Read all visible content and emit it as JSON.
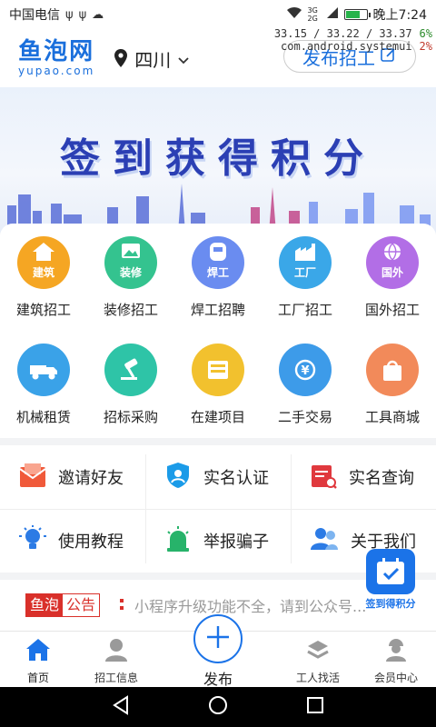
{
  "status_bar": {
    "carrier": "中国电信",
    "time": "晚上7:24",
    "battery_level": 0.75,
    "net_label": "3G 2G"
  },
  "debug_overlay": {
    "line1": "33.15 / 33.22 / 33.37",
    "line1_pct": "6%",
    "line2": "com.android.systemui",
    "line2_pct": "2%"
  },
  "header": {
    "logo_cn": "鱼泡网",
    "logo_en": "yupao.com",
    "city": "四川",
    "publish_button": "发布招工"
  },
  "banner": {
    "title": "签到获得积分"
  },
  "categories_row1": [
    {
      "label": "建筑招工",
      "tag": "建筑",
      "color": "#f5a623",
      "icon": "house-icon"
    },
    {
      "label": "装修招工",
      "tag": "装修",
      "color": "#34c38f",
      "icon": "gallery-icon"
    },
    {
      "label": "焊工招聘",
      "tag": "焊工",
      "color": "#6a8cf0",
      "icon": "welding-mask-icon"
    },
    {
      "label": "工厂招工",
      "tag": "工厂",
      "color": "#3aa7e8",
      "icon": "factory-icon"
    },
    {
      "label": "国外招工",
      "tag": "国外",
      "color": "#b26ee6",
      "icon": "globe-icon"
    }
  ],
  "categories_row2": [
    {
      "label": "机械租赁",
      "color": "#3aa2e8",
      "icon": "truck-icon"
    },
    {
      "label": "招标采购",
      "color": "#2ec4a7",
      "icon": "gavel-icon"
    },
    {
      "label": "在建项目",
      "color": "#f2c12e",
      "icon": "building-icon"
    },
    {
      "label": "二手交易",
      "color": "#3d9be9",
      "icon": "yuan-exchange-icon"
    },
    {
      "label": "工具商城",
      "color": "#f28a5a",
      "icon": "shopping-bag-icon"
    }
  ],
  "tools": [
    {
      "label": "邀请好友",
      "icon": "invite-mail-icon",
      "color": "#f05a3a"
    },
    {
      "label": "实名认证",
      "icon": "shield-check-icon",
      "color": "#1b9be8"
    },
    {
      "label": "实名查询",
      "icon": "calendar-search-icon",
      "color": "#e0393e"
    },
    {
      "label": "使用教程",
      "icon": "lightbulb-icon",
      "color": "#2c7be5"
    },
    {
      "label": "举报骗子",
      "icon": "alarm-light-icon",
      "color": "#27b36a"
    },
    {
      "label": "关于我们",
      "icon": "users-icon",
      "color": "#2c7be5"
    }
  ],
  "float_sign": {
    "label": "签到得积分"
  },
  "notice": {
    "badge_left": "鱼泡",
    "badge_right": "公告",
    "text": "小程序升级功能不全，请到公众号..."
  },
  "tabbar": {
    "items": [
      {
        "label": "首页",
        "icon": "home-icon"
      },
      {
        "label": "招工信息",
        "icon": "worker-info-icon"
      },
      {
        "label": "发布",
        "icon": "plus-icon"
      },
      {
        "label": "工人找活",
        "icon": "helmet-stack-icon"
      },
      {
        "label": "会员中心",
        "icon": "member-icon"
      }
    ],
    "active_color": "#1b73e8"
  }
}
